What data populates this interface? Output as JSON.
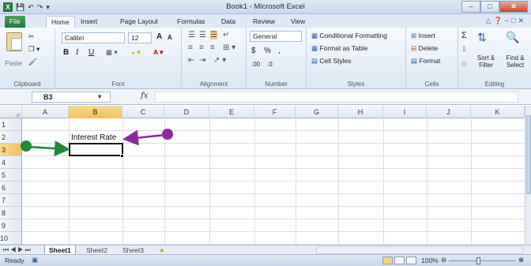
{
  "window": {
    "title": "Book1 - Microsoft Excel",
    "app_icon": "X",
    "quick_access": [
      "save-icon",
      "undo-icon",
      "redo-icon",
      "customize-icon"
    ],
    "controls": [
      "minimize",
      "restore",
      "close"
    ]
  },
  "ribbon": {
    "tabs": [
      "File",
      "Home",
      "Insert",
      "Page Layout",
      "Formulas",
      "Data",
      "Review",
      "View"
    ],
    "active_tab": "Home",
    "groups": {
      "clipboard": {
        "label": "Clipboard",
        "paste": "Paste"
      },
      "font": {
        "label": "Font",
        "name": "Calibri",
        "size": "12",
        "bold": "B",
        "italic": "I",
        "underline": "U",
        "grow": "A",
        "shrink": "A"
      },
      "alignment": {
        "label": "Alignment"
      },
      "number": {
        "label": "Number",
        "format": "General",
        "currency": "$",
        "percent": "%",
        "comma": ",",
        "inc_dec": ".00",
        "dec_dec": ".0"
      },
      "styles": {
        "label": "Styles",
        "conditional": "Conditional Formatting",
        "format_table": "Format as Table",
        "cell_styles": "Cell Styles"
      },
      "cells": {
        "label": "Cells",
        "insert": "Insert",
        "delete": "Delete",
        "format": "Format"
      },
      "editing": {
        "label": "Editing",
        "sort_filter": "Sort & Filter",
        "find_select": "Find & Select",
        "sigma": "Σ"
      }
    }
  },
  "formula_bar": {
    "name_box": "B3",
    "fx": "fx",
    "value": ""
  },
  "grid": {
    "columns": [
      "A",
      "B",
      "C",
      "D",
      "E",
      "F",
      "G",
      "H",
      "I",
      "J",
      "K"
    ],
    "rows": [
      "1",
      "2",
      "3",
      "4",
      "5",
      "6",
      "7",
      "8",
      "9",
      "10"
    ],
    "selected_column": "B",
    "selected_row": "3",
    "cells": {
      "B2": "Interest Rate"
    }
  },
  "annotations": {
    "arrow1_color": "#8b2a9c",
    "arrow2_color": "#1e8a3e"
  },
  "sheets": [
    "Sheet1",
    "Sheet2",
    "Sheet3"
  ],
  "active_sheet": "Sheet1",
  "status": {
    "ready": "Ready",
    "zoom": "100%"
  }
}
